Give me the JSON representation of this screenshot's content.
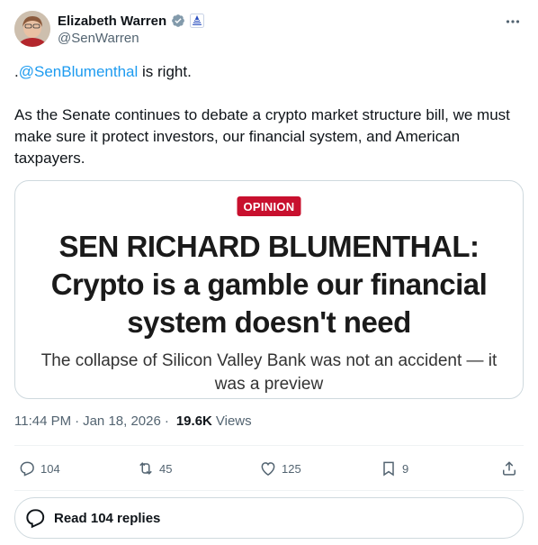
{
  "author": {
    "display_name": "Elizabeth Warren",
    "handle": "@SenWarren",
    "verified_icon": "verified-badge-icon",
    "affiliation_icon": "us-senate-badge-icon"
  },
  "tweet": {
    "mention_prefix": ".",
    "mention": "@SenBlumenthal",
    "mention_suffix": " is right.",
    "body": "As the Senate continues to debate a crypto market structure bill, we must make sure it protect investors, our financial system, and American taxpayers."
  },
  "card": {
    "label": "OPINION",
    "headline": "SEN RICHARD BLUMENTHAL: Crypto is a gamble our financial system doesn't need",
    "subhead": "The collapse of Silicon Valley Bank was not an accident — it was a preview"
  },
  "meta": {
    "time": "11:44 PM",
    "date": "Jan 18, 2026",
    "separator": "·",
    "views_count": "19.6K",
    "views_label": "Views"
  },
  "actions": {
    "replies": "104",
    "reposts": "45",
    "likes": "125",
    "bookmarks": "9"
  },
  "read_replies": "Read 104 replies",
  "colors": {
    "accent": "#1d9bf0",
    "text": "#0f1419",
    "muted": "#536471",
    "opinion_red": "#c8102e"
  }
}
